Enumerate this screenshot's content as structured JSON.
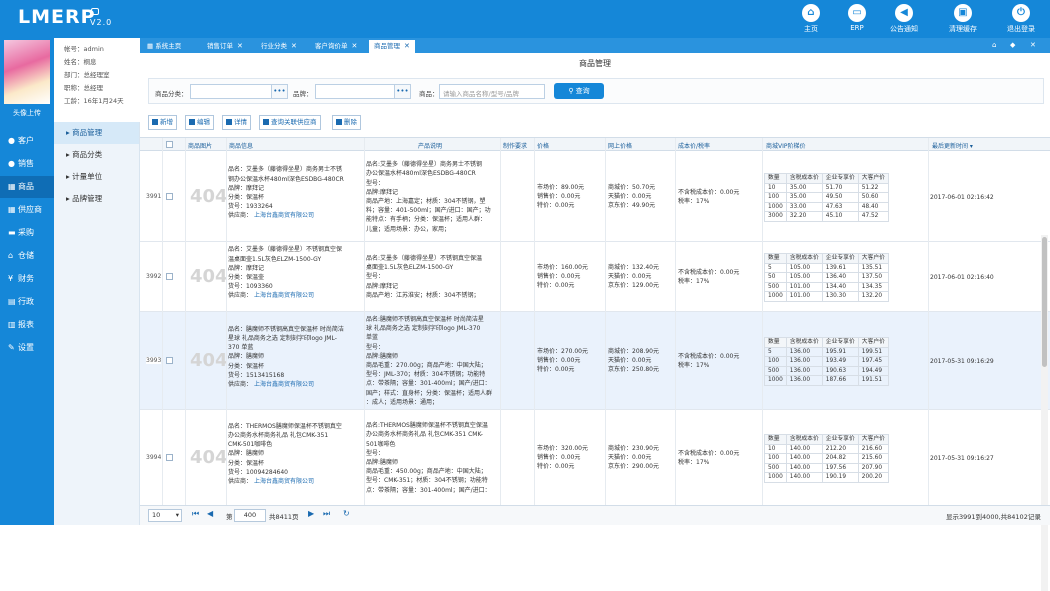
{
  "app": {
    "logo": "LMERP",
    "version": "V2.0"
  },
  "topnav": [
    {
      "label": "主页",
      "icon": "home-icon",
      "glyph": "⌂"
    },
    {
      "label": "ERP",
      "icon": "erp-icon",
      "glyph": "▭"
    },
    {
      "label": "公告通知",
      "icon": "speaker-icon",
      "glyph": "◀"
    },
    {
      "label": "清理缓存",
      "icon": "trash-icon",
      "glyph": "▣"
    },
    {
      "label": "退出登录",
      "icon": "power-icon",
      "glyph": "⏻"
    }
  ],
  "sidebar": {
    "avatar_label": "头像上传",
    "items": [
      {
        "label": "客户",
        "icon": "user-icon",
        "glyph": "●"
      },
      {
        "label": "销售",
        "icon": "people-icon",
        "glyph": "●"
      },
      {
        "label": "商品",
        "icon": "product-icon",
        "glyph": "▦"
      },
      {
        "label": "供应商",
        "icon": "supplier-icon",
        "glyph": "▦"
      },
      {
        "label": "采购",
        "icon": "cart-icon",
        "glyph": "▬"
      },
      {
        "label": "仓储",
        "icon": "warehouse-icon",
        "glyph": "⌂"
      },
      {
        "label": "财务",
        "icon": "yen-icon",
        "glyph": "¥"
      },
      {
        "label": "行政",
        "icon": "admin-icon",
        "glyph": "▤"
      },
      {
        "label": "报表",
        "icon": "report-icon",
        "glyph": "▥"
      },
      {
        "label": "设置",
        "icon": "wrench-icon",
        "glyph": "✎"
      }
    ]
  },
  "user": {
    "account": "帐号：admin",
    "name": "姓名：桐息",
    "dept": "部门：总经理室",
    "title": "职称：总经理",
    "tenure": "工龄：16年1月24天"
  },
  "subnav": [
    "商品管理",
    "商品分类",
    "计量单位",
    "品牌管理"
  ],
  "tabs": [
    {
      "label": "系统主页",
      "icon": true
    },
    {
      "label": "销售订单",
      "close": "✕"
    },
    {
      "label": "行业分类",
      "close": "✕"
    },
    {
      "label": "客户询价单",
      "close": "✕"
    },
    {
      "label": "商品管理",
      "close": "✕"
    }
  ],
  "page": {
    "title": "商品管理"
  },
  "search": {
    "category_label": "商品分类：",
    "brand_label": "品牌：",
    "product_label": "商品：",
    "product_placeholder": "请输入商品名称/型号/品牌",
    "dots": "•••",
    "button": "查询"
  },
  "toolbar": [
    "新增",
    "编辑",
    "详情",
    "查询关联供应商",
    "删除"
  ],
  "columns": {
    "img": "商品图片",
    "info": "商品信息",
    "desc": "产品说明",
    "req": "制作要求",
    "price": "价格",
    "online": "网上价格",
    "cost": "成本价/税率",
    "vip": "商城VIP阶梯价",
    "updated": "最后更新时间 ▾"
  },
  "rows": [
    {
      "no": "3991",
      "img": "404",
      "info": [
        "品名：艾墨多（藤德得坐星）商务男士不锈",
        "钢办公保温水杯480ml深色ESDBG-480CR",
        "品牌：摩拜记",
        "分类：保温杯",
        "货号：1933264",
        "供应商："
      ],
      "supplier": "上海台鑫商贸有限公司",
      "desc": [
        "品名:艾墨多（藤德得坐星）商务男士不锈钢",
        "办公保温水杯480ml深色ESDBG-480CR",
        "型号：",
        "品牌:摩拜记",
        "商品产地：上海嘉定；材质：304不锈钢，塑",
        "料；容量：401-500ml；国产/进口：国产；功",
        "能特点：有手柄；分类：保温杯；适用人群：",
        "儿童；适用场景：办公，家用；"
      ],
      "price": [
        "市场价：89.00元",
        "销售价：0.00元",
        "特价：0.00元"
      ],
      "online": [
        "商城价：50.70元",
        "天猫价：0.00元",
        "京东价：49.90元"
      ],
      "cost": [
        "不含税成本价：0.00元",
        "税率：17%"
      ],
      "vip": [
        [
          "数量",
          "含税成本价",
          "企业专享价",
          "大客户价"
        ],
        [
          "10",
          "35.00",
          "51.70",
          "51.22"
        ],
        [
          "100",
          "35.00",
          "49.50",
          "50.60"
        ],
        [
          "1000",
          "33.00",
          "47.63",
          "48.40"
        ],
        [
          "3000",
          "32.20",
          "45.10",
          "47.52"
        ]
      ],
      "updated": "2017-06-01 02:16:42"
    },
    {
      "no": "3992",
      "img": "404",
      "info": [
        "品名：艾墨多（藤德得坐星）不锈钢真空保",
        "温桌面壶1.5L灰色ELZM-1500-GY",
        "品牌：摩拜记",
        "分类：保温壶",
        "货号：1093360",
        "供应商："
      ],
      "supplier": "上海台鑫商贸有限公司",
      "desc": [
        "品名:艾墨多（藤德得坐星）不锈钢真空保温",
        "桌面壶1.5L灰色ELZM-1500-GY",
        "型号：",
        "品牌:摩拜记",
        "商品产地：江苏淮安；材质：304不锈钢；"
      ],
      "price": [
        "市场价：160.00元",
        "销售价：0.00元",
        "特价：0.00元"
      ],
      "online": [
        "商城价：132.40元",
        "天猫价：0.00元",
        "京东价：129.00元"
      ],
      "cost": [
        "不含税成本价：0.00元",
        "税率：17%"
      ],
      "vip": [
        [
          "数量",
          "含税成本价",
          "企业专享价",
          "大客户价"
        ],
        [
          "5",
          "105.00",
          "139.61",
          "135.51"
        ],
        [
          "50",
          "105.00",
          "136.40",
          "137.50"
        ],
        [
          "500",
          "101.00",
          "134.40",
          "134.35"
        ],
        [
          "1000",
          "101.00",
          "130.30",
          "132.20"
        ]
      ],
      "updated": "2017-06-01 02:16:40"
    },
    {
      "no": "3993",
      "img": "404",
      "selected": true,
      "info": [
        "品名：膳魔师不锈钢高真空保温杯 时尚简洁",
        "星球 礼品商务之选 定制刻字印logo JML-",
        "370 单蓝",
        "品牌：膳魔师",
        "分类：保温杯",
        "货号：1513415168",
        "供应商："
      ],
      "supplier": "上海台鑫商贸有限公司",
      "desc": [
        "品名:膳魔师不锈钢高真空保温杯 时尚简洁星",
        "球 礼品商务之选 定制刻字印logo JML-370",
        "单蓝",
        "型号：",
        "品牌:膳魔师",
        "商品毛重：270.00g；商品产地：中国大陆；",
        "型号：JML-370；材质：304不锈钢；功能特",
        "点：带茶隔；容量：301-400ml；国产/进口：",
        "国产；样式：直身杯；分类：保温杯；适用人群",
        "：成人；适用场景：通用；"
      ],
      "price": [
        "市场价：270.00元",
        "销售价：0.00元",
        "特价：0.00元"
      ],
      "online": [
        "商城价：208.90元",
        "天猫价：0.00元",
        "京东价：250.80元"
      ],
      "cost": [
        "不含税成本价：0.00元",
        "税率：17%"
      ],
      "vip": [
        [
          "数量",
          "含税成本价",
          "企业专享价",
          "大客户价"
        ],
        [
          "5",
          "136.00",
          "195.91",
          "199.51"
        ],
        [
          "100",
          "136.00",
          "193.49",
          "197.45"
        ],
        [
          "500",
          "136.00",
          "190.63",
          "194.49"
        ],
        [
          "1000",
          "136.00",
          "187.66",
          "191.51"
        ]
      ],
      "updated": "2017-05-31 09:16:29"
    },
    {
      "no": "3994",
      "img": "404",
      "info": [
        "品名：THERMOS膳魔师保温杯不锈钢真空",
        "办公商务水杯商务礼品 礼包CMK-351",
        "CMK-501咖啡色",
        "品牌：膳魔师",
        "分类：保温杯",
        "货号：10094284640",
        "供应商："
      ],
      "supplier": "上海台鑫商贸有限公司",
      "desc": [
        "品名:THERMOS膳魔师保温杯不锈钢真空保温",
        "办公商务水杯商务礼品 礼包CMK-351 CMK-",
        "501咖啡色",
        "型号：",
        "品牌:膳魔师",
        "商品毛重：450.00g；商品产地：中国大陆；",
        "型号：CMK-351；材质：304不锈钢；功能特",
        "点：带茶隔；容量：301-400ml；国产/进口："
      ],
      "price": [
        "市场价：320.00元",
        "销售价：0.00元",
        "特价：0.00元"
      ],
      "online": [
        "商城价：230.90元",
        "天猫价：0.00元",
        "京东价：290.00元"
      ],
      "cost": [
        "不含税成本价：0.00元",
        "税率：17%"
      ],
      "vip": [
        [
          "数量",
          "含税成本价",
          "企业专享价",
          "大客户价"
        ],
        [
          "10",
          "140.00",
          "212.20",
          "216.60"
        ],
        [
          "100",
          "140.00",
          "204.82",
          "215.60"
        ],
        [
          "500",
          "140.00",
          "197.56",
          "207.90"
        ],
        [
          "1000",
          "140.00",
          "190.19",
          "200.20"
        ]
      ],
      "updated": "2017-05-31 09:16:27"
    }
  ],
  "pager": {
    "size": "10",
    "page_prefix": "第",
    "page": "400",
    "page_suffix": "共8411页",
    "summary": "显示3991到4000,共84102记录"
  },
  "colors": {
    "primary": "#1587d8",
    "link": "#1a6ab0"
  }
}
